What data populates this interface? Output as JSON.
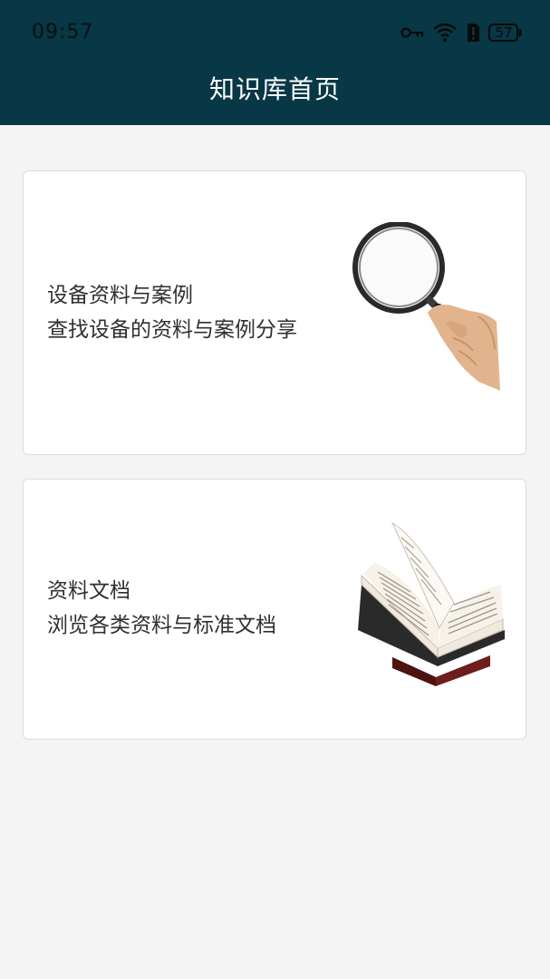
{
  "status_bar": {
    "time": "09:57",
    "battery": "57",
    "icons": [
      "key-icon",
      "wifi-icon",
      "alert-icon",
      "battery-icon"
    ]
  },
  "header": {
    "title": "知识库首页",
    "background_color": "#083746"
  },
  "cards": [
    {
      "title": "设备资料与案例",
      "description": "查找设备的资料与案例分享",
      "image": "magnifying-glass-illustration"
    },
    {
      "title": "资料文档",
      "description": "浏览各类资料与标准文档",
      "image": "open-book-illustration"
    }
  ]
}
